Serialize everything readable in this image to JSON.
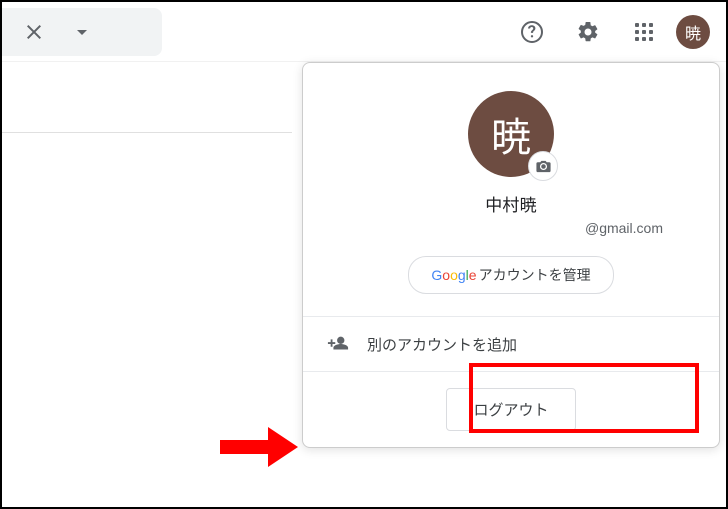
{
  "avatar_initial": "暁",
  "user": {
    "name": "中村暁",
    "email": "@gmail.com"
  },
  "buttons": {
    "google_prefix": "Google",
    "manage_account": " アカウントを管理",
    "add_account": "別のアカウントを追加",
    "logout": "ログアウト"
  }
}
